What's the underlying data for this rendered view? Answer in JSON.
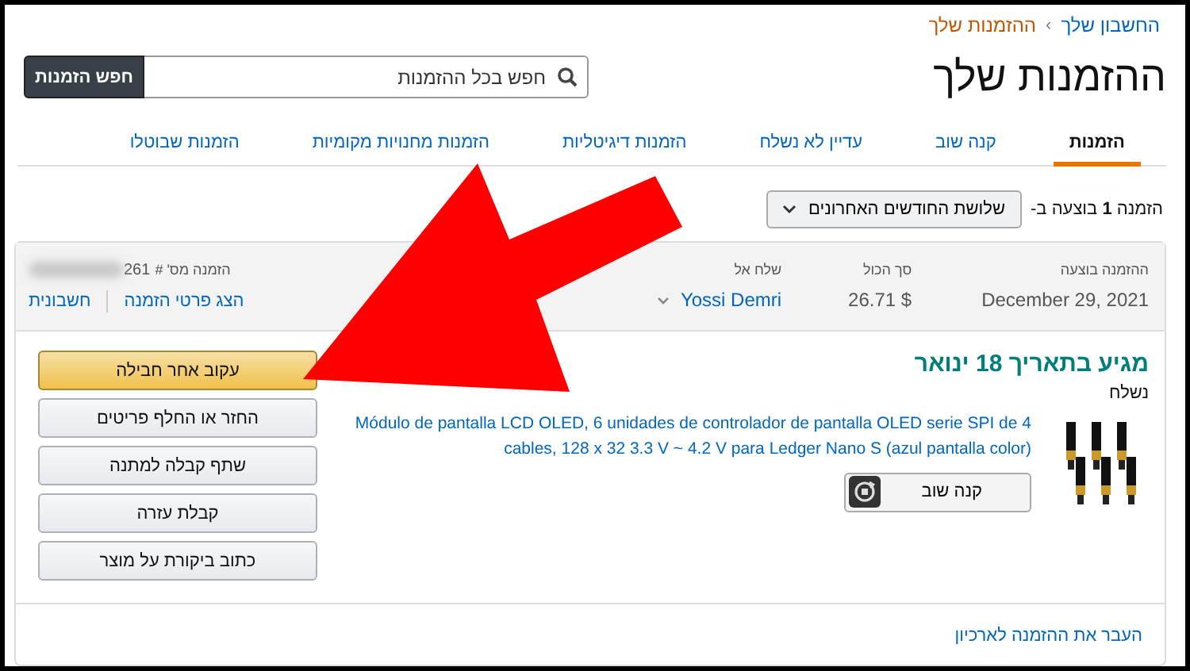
{
  "breadcrumb": {
    "items": [
      {
        "label": "החשבון שלך",
        "selected": false
      },
      {
        "label": "ההזמנות שלך",
        "selected": true
      }
    ],
    "separator": "›"
  },
  "page_title": "ההזמנות שלך",
  "search": {
    "placeholder": "חפש בכל ההזמנות",
    "button": "חפש הזמנות"
  },
  "tabs": [
    {
      "label": "הזמנות",
      "selected": true
    },
    {
      "label": "קנה שוב",
      "selected": false
    },
    {
      "label": "עדיין לא נשלח",
      "selected": false
    },
    {
      "label": "הזמנות דיגיטליות",
      "selected": false
    },
    {
      "label": "הזמנות מחנויות מקומיות",
      "selected": false
    },
    {
      "label": "הזמנות שבוטלו",
      "selected": false
    }
  ],
  "filter": {
    "summary": "הזמנה **1** בוצעה ב-",
    "period": "שלושת החודשים האחרונים"
  },
  "order": {
    "placed_label": "ההזמנה בוצעה",
    "placed_date": "December 29, 2021",
    "total_label": "סך הכול",
    "total": "$ 26.71",
    "ship_to_label": "שלח אל",
    "ship_to": "Yossi Demri",
    "number_label": "הזמנה מס' #",
    "number_tail": "261",
    "details_link": "הצג פרטי הזמנה",
    "invoice_link": "חשבונית",
    "delivery_status": "מגיע בתאריך 18 ינואר",
    "shipment_state": "נשלח",
    "product": {
      "title": "Módulo de pantalla LCD OLED, 6 unidades de controlador de pantalla OLED serie SPI de 4 cables, 128 x 32 3.3 V ~ 4.2 V para Ledger Nano S (azul pantalla color)",
      "buy_again": "קנה שוב"
    },
    "actions": [
      {
        "label": "עקוב אחר חבילה",
        "kind": "primary"
      },
      {
        "label": "החזר או החלף פריטים",
        "kind": "secondary"
      },
      {
        "label": "שתף קבלה למתנה",
        "kind": "secondary"
      },
      {
        "label": "קבלת עזרה",
        "kind": "secondary"
      },
      {
        "label": "כתוב ביקורת על מוצר",
        "kind": "secondary"
      }
    ],
    "archive_link": "העבר את ההזמנה לארכיון"
  }
}
